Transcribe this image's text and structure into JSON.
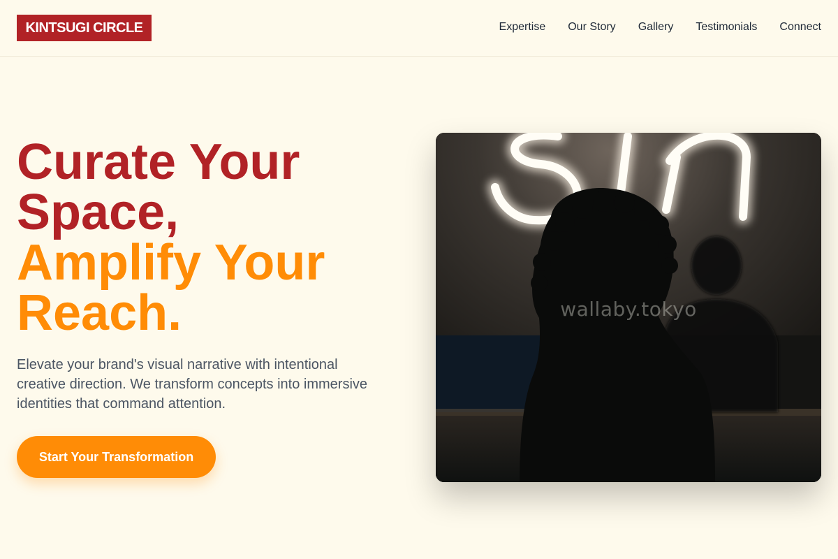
{
  "brand": {
    "name": "KINTSUGI CIRCLE",
    "color": "#b12226"
  },
  "nav": {
    "items": [
      {
        "label": "Expertise"
      },
      {
        "label": "Our Story"
      },
      {
        "label": "Gallery"
      },
      {
        "label": "Testimonials"
      },
      {
        "label": "Connect"
      }
    ]
  },
  "hero": {
    "headline_line1": "Curate Your",
    "headline_line2": "Space,",
    "headline_line3": "Amplify Your",
    "headline_line4": "Reach.",
    "subtext": "Elevate your brand's visual narrative with intentional creative direction. We transform concepts into immersive identities that command attention.",
    "cta_label": "Start Your Transformation",
    "accent_color": "#ff8c06"
  },
  "image": {
    "watermark": "wallaby.tokyo",
    "description_icon": "photo-neon-sign-silhouette"
  }
}
